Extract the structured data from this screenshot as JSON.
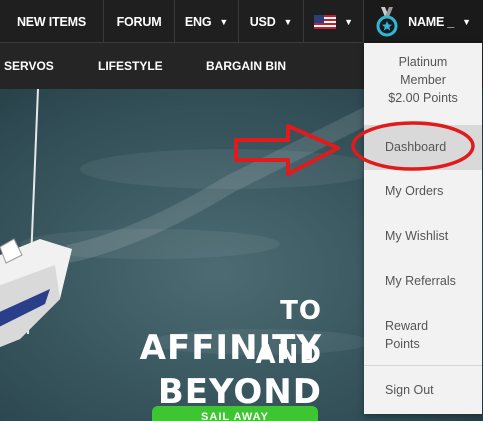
{
  "topbar": {
    "new_items": "NEW ITEMS",
    "forum": "FORUM",
    "language": "ENG",
    "currency": "USD",
    "user_name": "NAME _",
    "flag_icon": "us-flag-icon",
    "badge_icon": "medal-icon",
    "caret_icon": "caret-down-icon",
    "caret_glyph": "▼"
  },
  "subnav": {
    "items": [
      "SERVOS",
      "LIFESTYLE",
      "BARGAIN BIN"
    ]
  },
  "hero": {
    "line1_small": "TO",
    "line1_big": "AFFINITY",
    "line2_small": "AND",
    "line2_big": "BEYOND",
    "cta_label": "SAIL AWAY"
  },
  "user_menu": {
    "member_line1": "Platinum",
    "member_line2": "Member",
    "points": "$2.00 Points",
    "items": {
      "dashboard": "Dashboard",
      "my_orders": "My Orders",
      "my_wishlist": "My Wishlist",
      "my_referrals": "My Referrals",
      "reward_line1": "Reward",
      "reward_line2": "Points",
      "sign_out": "Sign Out"
    }
  },
  "colors": {
    "topbar_bg": "#1f1f1f",
    "annotation_red": "#e01b1b",
    "cta_green": "#3ec532",
    "badge_cyan": "#2fb8d6"
  }
}
